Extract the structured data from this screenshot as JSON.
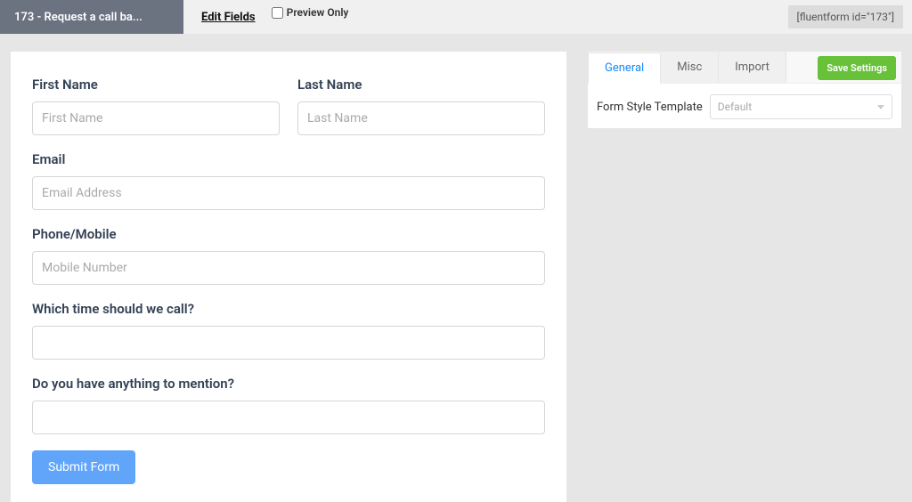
{
  "topbar": {
    "formTitle": "173 - Request a call ba...",
    "editFields": "Edit Fields",
    "previewOnly": "Preview Only",
    "shortcode": "[fluentform id=\"173\"]"
  },
  "form": {
    "firstName": {
      "label": "First Name",
      "placeholder": "First Name"
    },
    "lastName": {
      "label": "Last Name",
      "placeholder": "Last Name"
    },
    "email": {
      "label": "Email",
      "placeholder": "Email Address"
    },
    "phone": {
      "label": "Phone/Mobile",
      "placeholder": "Mobile Number"
    },
    "callTime": {
      "label": "Which time should we call?",
      "placeholder": ""
    },
    "mention": {
      "label": "Do you have anything to mention?",
      "placeholder": ""
    },
    "submitLabel": "Submit Form"
  },
  "sidebar": {
    "tabs": {
      "general": "General",
      "misc": "Misc",
      "import": "Import"
    },
    "saveSettings": "Save Settings",
    "formStyleTemplate": {
      "label": "Form Style Template",
      "value": "Default"
    }
  }
}
